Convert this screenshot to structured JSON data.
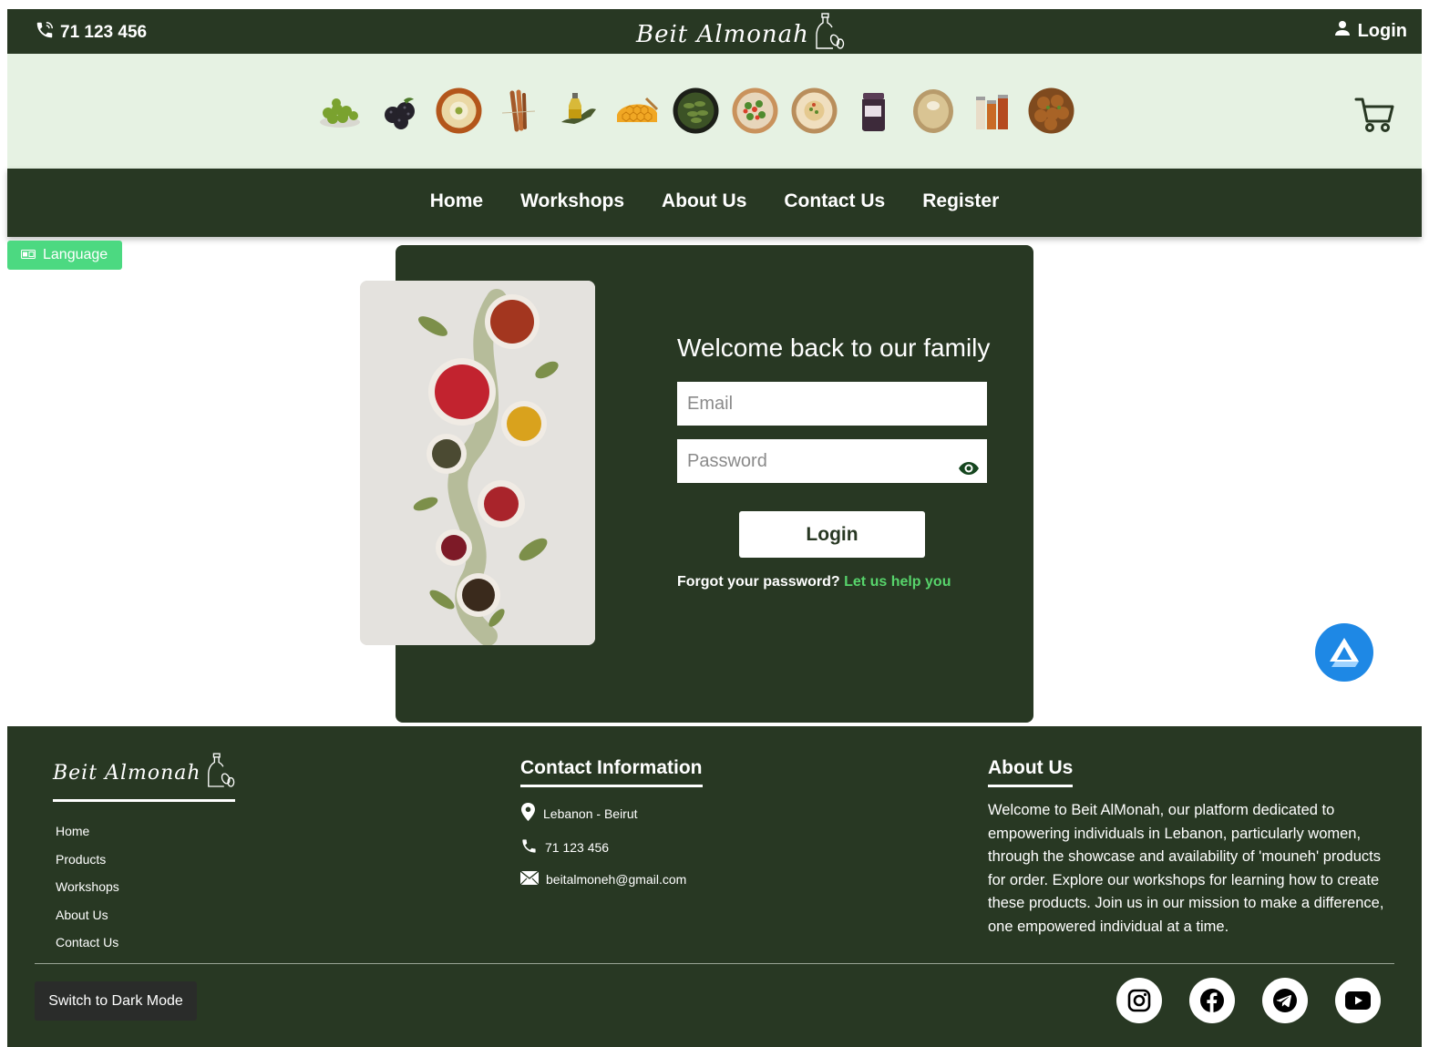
{
  "header": {
    "phone": "71 123 456",
    "brand": "Beit Almonah",
    "login_label": "Login",
    "phone_icon": "phone-icon",
    "user_icon": "user-icon",
    "logo_icon": "olive-oil-bottle-icon"
  },
  "categories": [
    {
      "name": "olives",
      "icon": "olives-icon"
    },
    {
      "name": "blackberries",
      "icon": "blackberries-icon"
    },
    {
      "name": "labneh",
      "icon": "labneh-bowl-icon"
    },
    {
      "name": "cinnamon",
      "icon": "cinnamon-icon"
    },
    {
      "name": "olive oil",
      "icon": "olive-oil-icon"
    },
    {
      "name": "honey",
      "icon": "honeycomb-icon"
    },
    {
      "name": "stuffed grape leaves",
      "icon": "grape-leaves-icon"
    },
    {
      "name": "salad",
      "icon": "salad-icon"
    },
    {
      "name": "mezze",
      "icon": "mezze-plate-icon"
    },
    {
      "name": "jam",
      "icon": "jam-jar-icon"
    },
    {
      "name": "bread",
      "icon": "bread-icon"
    },
    {
      "name": "spices",
      "icon": "spice-jars-icon"
    },
    {
      "name": "falafel",
      "icon": "falafel-icon"
    }
  ],
  "cart_icon": "cart-icon",
  "nav": {
    "home": "Home",
    "workshops": "Workshops",
    "about": "About Us",
    "contact": "Contact Us",
    "register": "Register"
  },
  "language_button": "Language",
  "login_form": {
    "heading": "Welcome back to our family",
    "email_placeholder": "Email",
    "password_placeholder": "Password",
    "submit_label": "Login",
    "forgot_text": "Forgot your password?",
    "help_link": "Let us help you"
  },
  "footer": {
    "brand": "Beit Almonah",
    "links": [
      "Home",
      "Products",
      "Workshops",
      "About Us",
      "Contact Us"
    ],
    "contact_heading": "Contact Information",
    "location": "Lebanon - Beirut",
    "phone": "71 123 456",
    "email": "beitalmoneh@gmail.com",
    "about_heading": "About Us",
    "about_text": "Welcome to Beit AlMonah, our platform dedicated to empowering individuals in Lebanon, particularly women, through the showcase and availability of 'mouneh' products for order. Explore our workshops for learning how to create these products. Join us in our mission to make a difference, one empowered individual at a time.",
    "dark_mode_label": "Switch to Dark Mode",
    "socials": [
      "instagram-icon",
      "facebook-icon",
      "telegram-icon",
      "youtube-icon"
    ]
  },
  "colors": {
    "primary": "#283823",
    "category_bar": "#e6f2e3",
    "accent_green": "#4cd981",
    "link_green": "#57d46b",
    "fab_blue": "#1e88e5"
  }
}
